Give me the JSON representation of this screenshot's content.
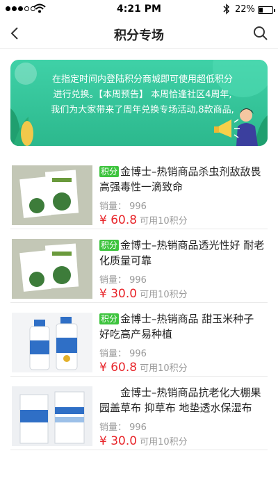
{
  "status_bar": {
    "time": "4:21 PM",
    "battery": "22%"
  },
  "nav": {
    "title": "积分专场"
  },
  "banner": {
    "text": "在指定时间内登陆积分商城即可使用超低积分进行兑换。【本周预告】 本周恰逢社区4周年,我们为大家带来了周年兑换专场活动,8款商品,"
  },
  "products": [
    {
      "tag": "积分",
      "title": "金博士–热销商品杀虫剂敌敌畏高强毒性一滴致命",
      "sales": "销量： 996",
      "price": "¥ 60.8",
      "points": "可用10积分"
    },
    {
      "tag": "积分",
      "title": "金博士–热销商品透光性好 耐老化质量可靠",
      "sales": "销量： 996",
      "price": "¥ 30.0",
      "points": "可用10积分"
    },
    {
      "tag": "积分",
      "title": "金博士–热销商品 甜玉米种子 好吃高产易种植",
      "sales": "销量： 996",
      "price": "¥ 60.8",
      "points": "可用10积分"
    },
    {
      "tag": "",
      "title": "金博士–热销商品抗老化大棚果园盖草布 抑草布 地垫透水保湿布",
      "sales": "销量： 996",
      "price": "¥ 30.0",
      "points": "可用10积分"
    }
  ],
  "colors": {
    "accent_green": "#3ec43e",
    "price_red": "#e8262b",
    "banner_green": "#2cb88d"
  }
}
